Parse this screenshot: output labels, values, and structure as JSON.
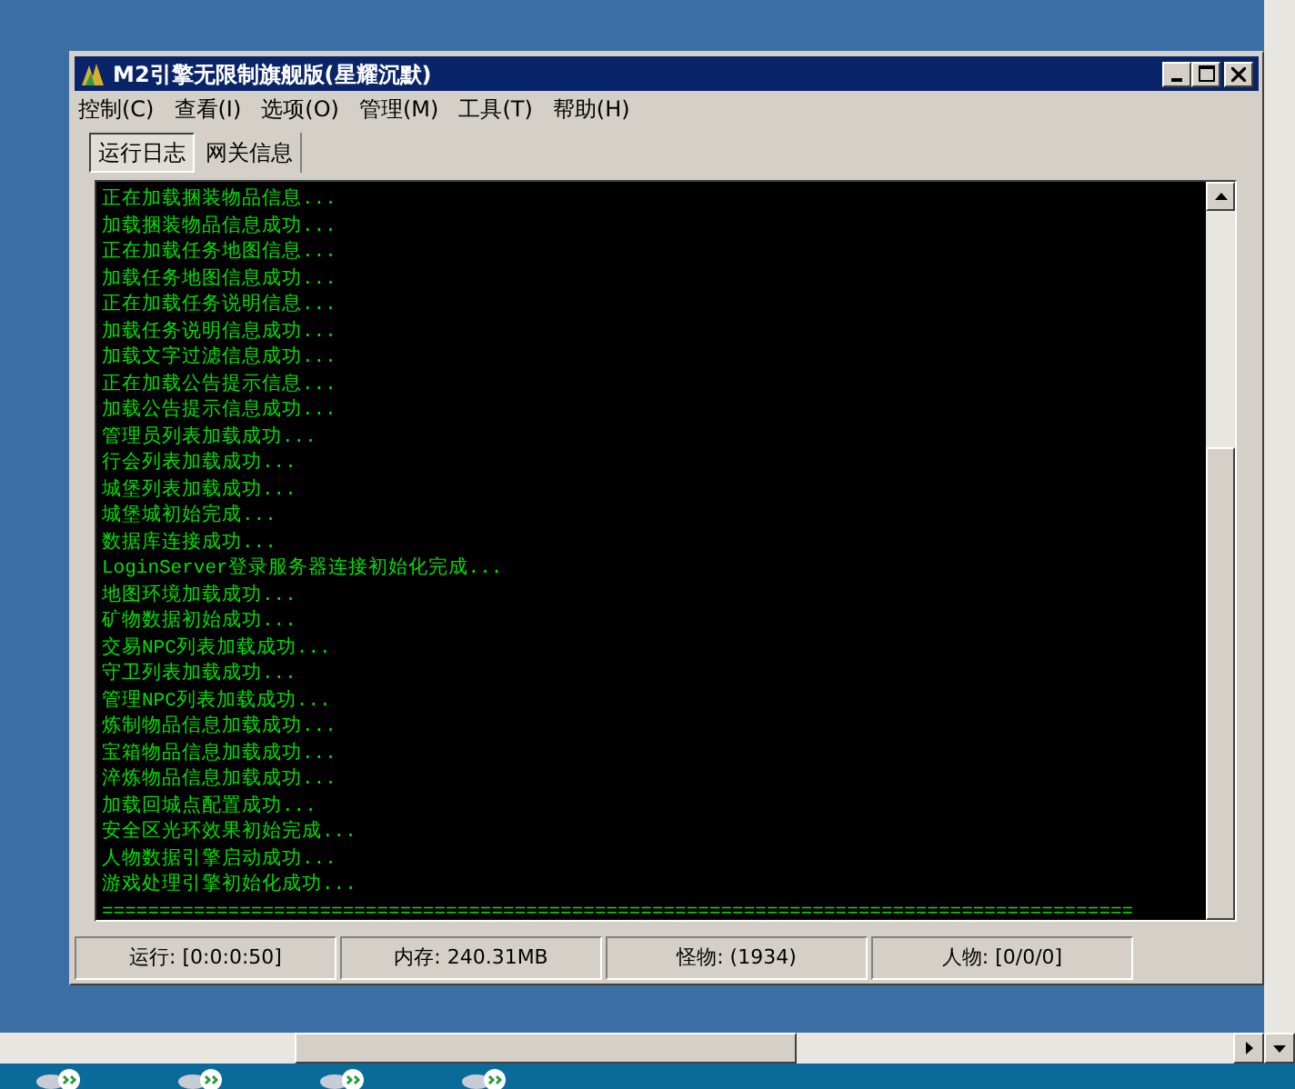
{
  "window": {
    "title": "M2引擎无限制旗舰版(星耀沉默)"
  },
  "menu": [
    "控制(C)",
    "查看(I)",
    "选项(O)",
    "管理(M)",
    "工具(T)",
    "帮助(H)"
  ],
  "tabs": [
    {
      "label": "运行日志",
      "selected": true
    },
    {
      "label": "网关信息",
      "selected": false
    }
  ],
  "log": [
    "正在加载捆装物品信息...",
    "加载捆装物品信息成功...",
    "正在加载任务地图信息...",
    "加载任务地图信息成功...",
    "正在加载任务说明信息...",
    "加载任务说明信息成功...",
    "加载文字过滤信息成功...",
    "正在加载公告提示信息...",
    "加载公告提示信息成功...",
    "管理员列表加载成功...",
    "行会列表加载成功...",
    "城堡列表加载成功...",
    "城堡城初始完成...",
    "数据库连接成功...",
    "LoginServer登录服务器连接初始化完成...",
    "地图环境加载成功...",
    "矿物数据初始成功...",
    "交易NPC列表加载成功...",
    "守卫列表加载成功...",
    "管理NPC列表加载成功...",
    "炼制物品信息加载成功...",
    "宝箱物品信息加载成功...",
    "淬炼物品信息加载成功...",
    "加载回城点配置成功...",
    "安全区光环效果初始完成...",
    "人物数据引擎启动成功...",
    "游戏处理引擎初始化成功...",
    "=========================================================================================="
  ],
  "status_bar": [
    "运行: [0:0:0:50]",
    "内存: 240.31MB",
    "怪物: (1934)",
    "人物: [0/0/0]"
  ]
}
